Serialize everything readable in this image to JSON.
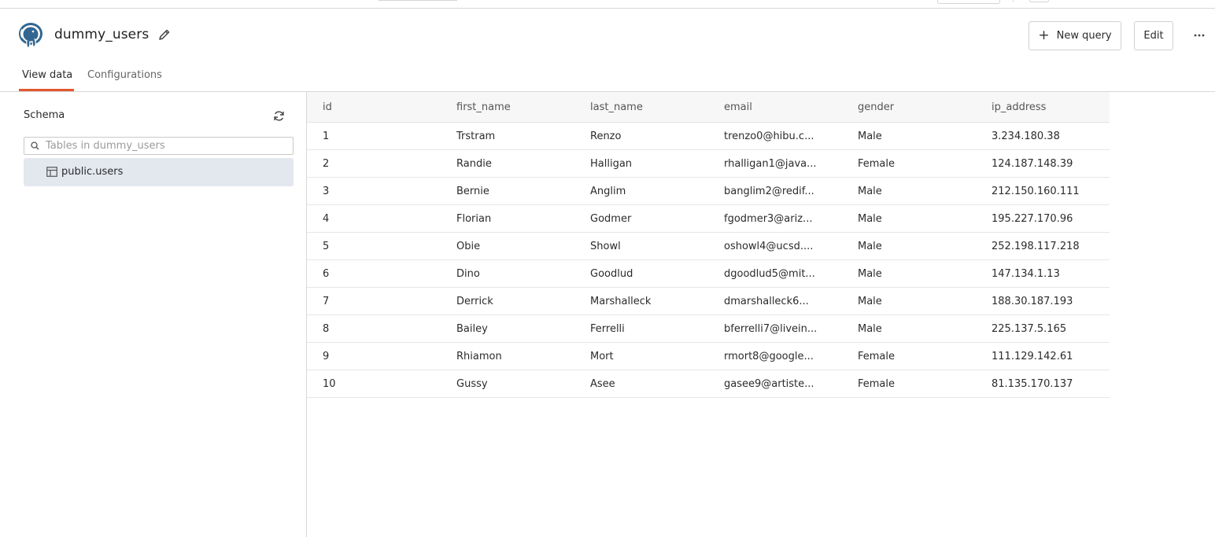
{
  "header": {
    "title": "dummy_users",
    "new_query_label": "New query",
    "edit_label": "Edit",
    "more_label": "···"
  },
  "tabs": [
    {
      "label": "View data",
      "active": true
    },
    {
      "label": "Configurations",
      "active": false
    }
  ],
  "sidebar": {
    "schema_label": "Schema",
    "search_placeholder": "Tables in dummy_users",
    "search_value": "",
    "tables": [
      {
        "label": "public.users",
        "selected": true
      }
    ]
  },
  "table": {
    "columns": [
      "id",
      "first_name",
      "last_name",
      "email",
      "gender",
      "ip_address"
    ],
    "rows": [
      [
        "1",
        "Trstram",
        "Renzo",
        "trenzo0@hibu.c...",
        "Male",
        "3.234.180.38"
      ],
      [
        "2",
        "Randie",
        "Halligan",
        "rhalligan1@java....",
        "Female",
        "124.187.148.39"
      ],
      [
        "3",
        "Bernie",
        "Anglim",
        "banglim2@redif...",
        "Male",
        "212.150.160.111"
      ],
      [
        "4",
        "Florian",
        "Godmer",
        "fgodmer3@ariz...",
        "Male",
        "195.227.170.96"
      ],
      [
        "5",
        "Obie",
        "Showl",
        "oshowl4@ucsd....",
        "Male",
        "252.198.117.218"
      ],
      [
        "6",
        "Dino",
        "Goodlud",
        "dgoodlud5@mit...",
        "Male",
        "147.134.1.13"
      ],
      [
        "7",
        "Derrick",
        "Marshalleck",
        "dmarshalleck6...",
        "Male",
        "188.30.187.193"
      ],
      [
        "8",
        "Bailey",
        "Ferrelli",
        "bferrelli7@livein...",
        "Male",
        "225.137.5.165"
      ],
      [
        "9",
        "Rhiamon",
        "Mort",
        "rmort8@google...",
        "Female",
        "111.129.142.61"
      ],
      [
        "10",
        "Gussy",
        "Asee",
        "gasee9@artiste...",
        "Female",
        "81.135.170.137"
      ]
    ]
  },
  "colors": {
    "accent": "#e4572e",
    "selected_bg": "#e3e7ee",
    "logo_blue": "#336791"
  },
  "icons": {
    "logo": "postgresql-elephant-logo",
    "edit_title": "pencil-icon",
    "new_query": "plus-icon",
    "more": "ellipsis-icon",
    "refresh": "refresh-icon",
    "search": "search-icon",
    "table": "table-icon"
  }
}
